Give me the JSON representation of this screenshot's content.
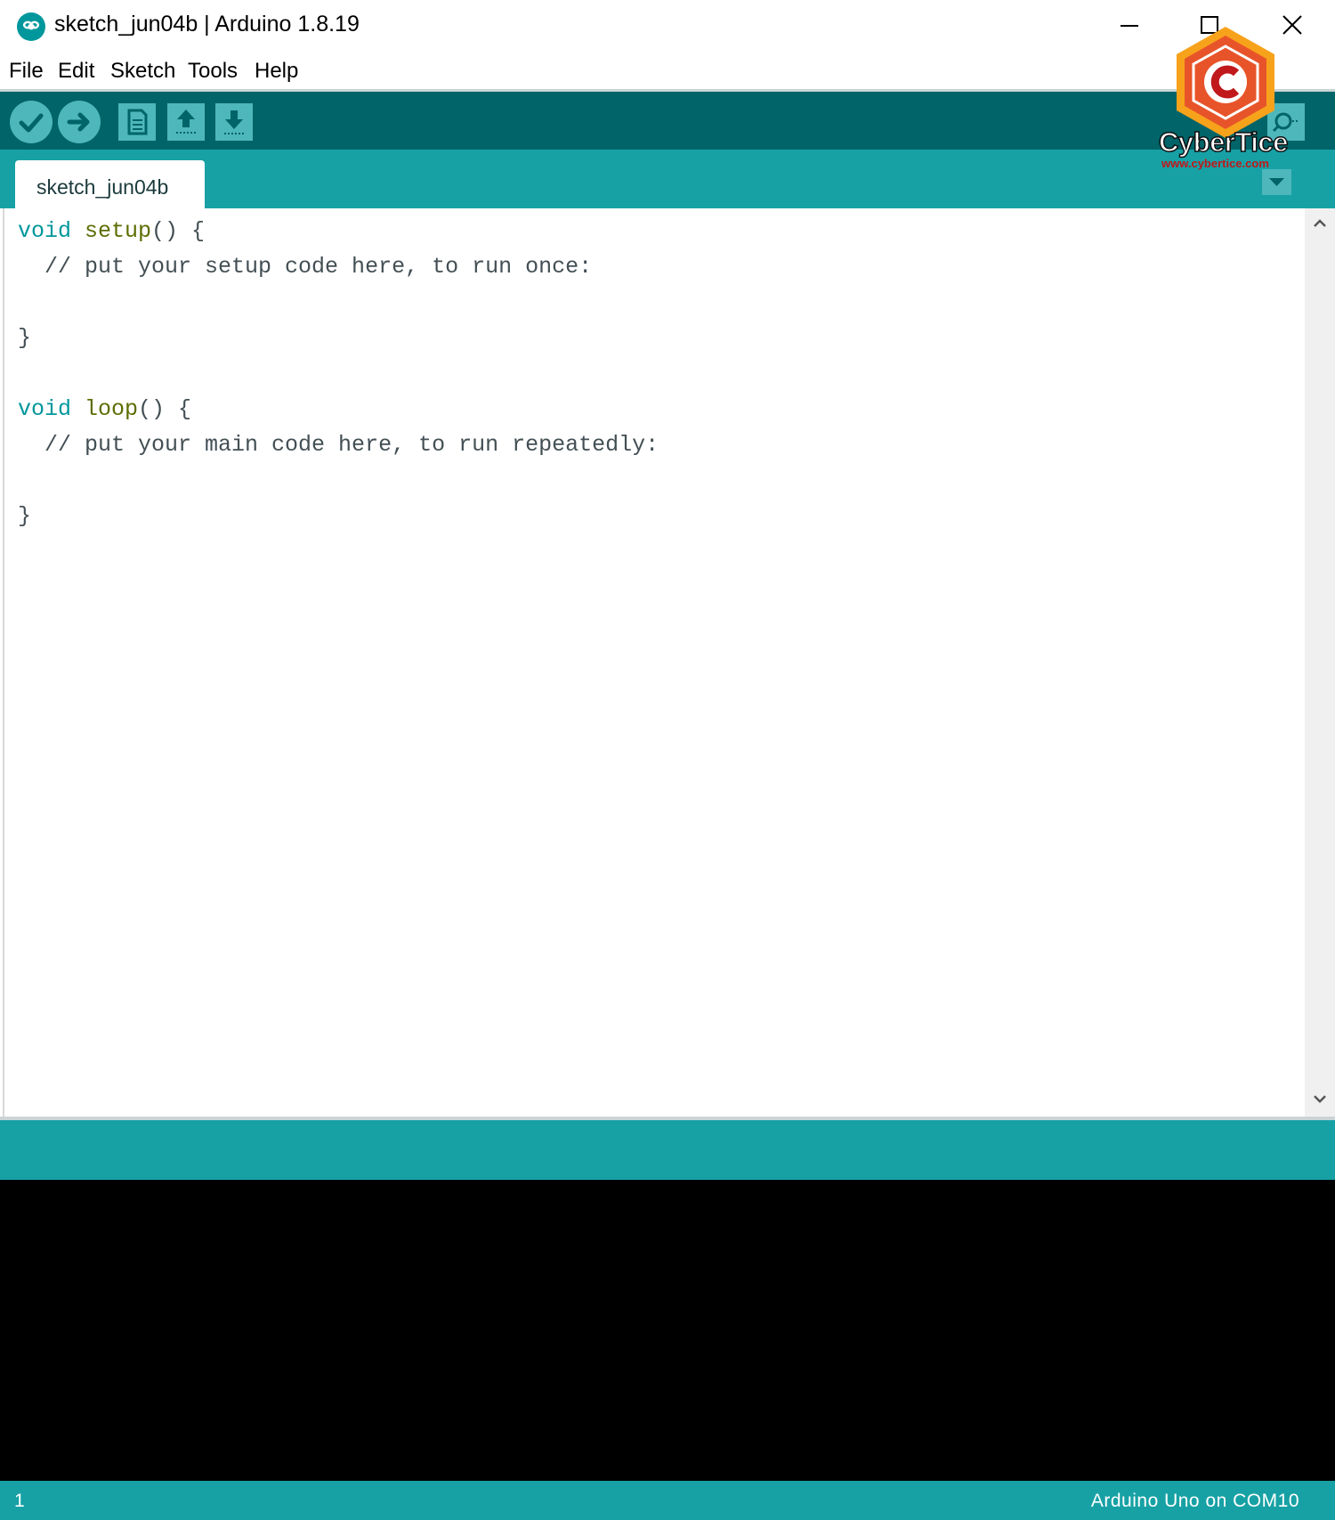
{
  "window": {
    "title": "sketch_jun04b | Arduino 1.8.19",
    "app_icon": "arduino-infinity-icon",
    "controls": [
      "minimize-icon",
      "maximize-icon",
      "close-icon"
    ]
  },
  "menu": {
    "items": [
      {
        "label": "File"
      },
      {
        "label": "Edit"
      },
      {
        "label": "Sketch"
      },
      {
        "label": "Tools"
      },
      {
        "label": "Help"
      }
    ]
  },
  "toolbar": {
    "buttons": [
      "verify-icon",
      "upload-icon",
      "new-icon",
      "open-icon",
      "save-icon",
      "serial-monitor-icon"
    ]
  },
  "tabs": [
    {
      "label": "sketch_jun04b",
      "active": true
    }
  ],
  "editor": {
    "lines": [
      {
        "t1": "void",
        "t2": " ",
        "t3": "setup",
        "t4": "() {",
        "t5": ""
      },
      {
        "t1": "",
        "t2": "  // put your setup code here, to run once:",
        "t3": "",
        "t4": "",
        "t5": ""
      },
      {
        "t1": "",
        "t2": "",
        "t3": "",
        "t4": "",
        "t5": ""
      },
      {
        "t1": "",
        "t2": "}",
        "t3": "",
        "t4": "",
        "t5": ""
      },
      {
        "t1": "",
        "t2": "",
        "t3": "",
        "t4": "",
        "t5": ""
      },
      {
        "t1": "void",
        "t2": " ",
        "t3": "loop",
        "t4": "() {",
        "t5": ""
      },
      {
        "t1": "",
        "t2": "  // put your main code here, to run repeatedly:",
        "t3": "",
        "t4": "",
        "t5": ""
      },
      {
        "t1": "",
        "t2": "",
        "t3": "",
        "t4": "",
        "t5": ""
      },
      {
        "t1": "",
        "t2": "}",
        "t3": "",
        "t4": "",
        "t5": ""
      }
    ]
  },
  "status": {
    "line_number": "1",
    "board": "Arduino Uno on COM10"
  },
  "watermark": {
    "name": "CyberTice",
    "url": "www.cybertice.com"
  },
  "colors": {
    "toolbar": "#006468",
    "tabstrip": "#17a1a5",
    "button": "#4db7bb",
    "console": "#000000",
    "keyword": "#00979c",
    "function": "#5e6d03"
  }
}
